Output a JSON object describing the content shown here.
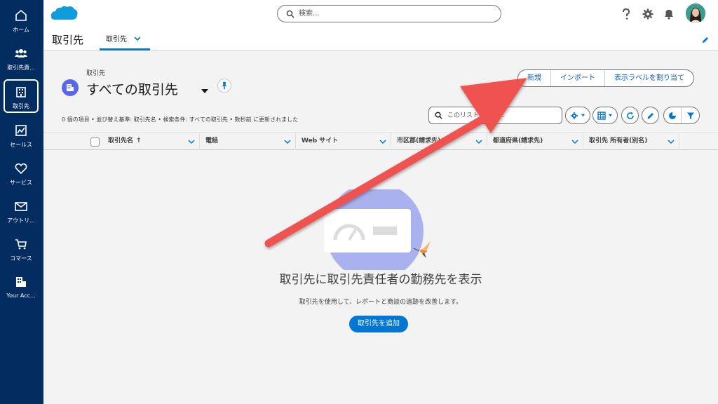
{
  "rail": {
    "items": [
      {
        "label": "ホーム",
        "icon": "home-icon"
      },
      {
        "label": "取引先責...",
        "icon": "contacts-icon"
      },
      {
        "label": "取引先",
        "icon": "accounts-icon",
        "active": true
      },
      {
        "label": "セールス",
        "icon": "sales-chart-icon"
      },
      {
        "label": "サービス",
        "icon": "heart-icon"
      },
      {
        "label": "アウトリ...",
        "icon": "mail-icon"
      },
      {
        "label": "コマース",
        "icon": "cart-icon"
      },
      {
        "label": "Your Acc...",
        "icon": "building-icon"
      }
    ]
  },
  "header": {
    "search_placeholder": "検索...",
    "app_name": "取引先",
    "tab_label": "取引先"
  },
  "page": {
    "object_label": "取引先",
    "list_view_title": "すべての取引先",
    "buttons": [
      "新規",
      "インポート",
      "表示ラベルを割り当て"
    ],
    "meta_text": "0 個の項目 • 並び替え基準: 取引先名 • 検索条件: すべての取引先 • 数秒前 に更新されました",
    "list_search_placeholder": "このリストを検索..."
  },
  "table": {
    "columns": [
      "取引先名",
      "電話",
      "Web サイト",
      "市区郡(請求先)",
      "都道府県(請求先)",
      "取引先 所有者(別名)"
    ],
    "sort_indicator": "↑"
  },
  "empty_state": {
    "title": "取引先に取引先責任者の勤務先を表示",
    "subtitle": "取引先を使用して、レポートと商談の追跡を改善します。",
    "button": "取引先を追加"
  },
  "colors": {
    "rail_bg": "#032d60",
    "brand_blue": "#0176d3",
    "annotation_arrow": "#f0524f"
  }
}
